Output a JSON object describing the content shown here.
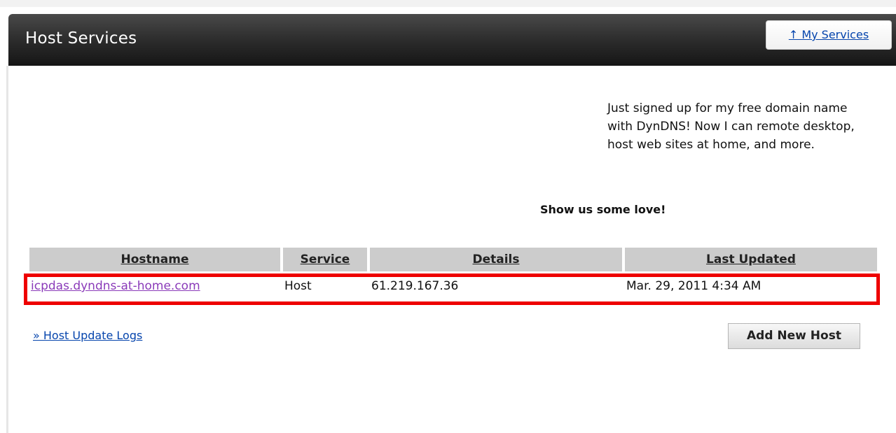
{
  "header": {
    "title": "Host Services",
    "my_services_label": "↑ My Services"
  },
  "promo": {
    "message": "Just signed up for my free domain name with DynDNS! Now I can remote desktop, host web sites at home, and more.",
    "love": "Show us some love!"
  },
  "table": {
    "columns": [
      "Hostname",
      "Service",
      "Details",
      "Last Updated"
    ],
    "rows": [
      {
        "hostname": "icpdas.dyndns-at-home.com",
        "service": "Host",
        "details": "61.219.167.36",
        "last_updated": "Mar. 29, 2011 4:34 AM"
      }
    ]
  },
  "footer": {
    "update_logs_label": "» Host Update Logs",
    "add_host_label": "Add New Host"
  },
  "colors": {
    "highlight": "#ee0000",
    "link": "#0645ad",
    "visited_link": "#8a3ab9",
    "header_bg": "#2f2f2f",
    "table_header_bg": "#cccccc"
  }
}
